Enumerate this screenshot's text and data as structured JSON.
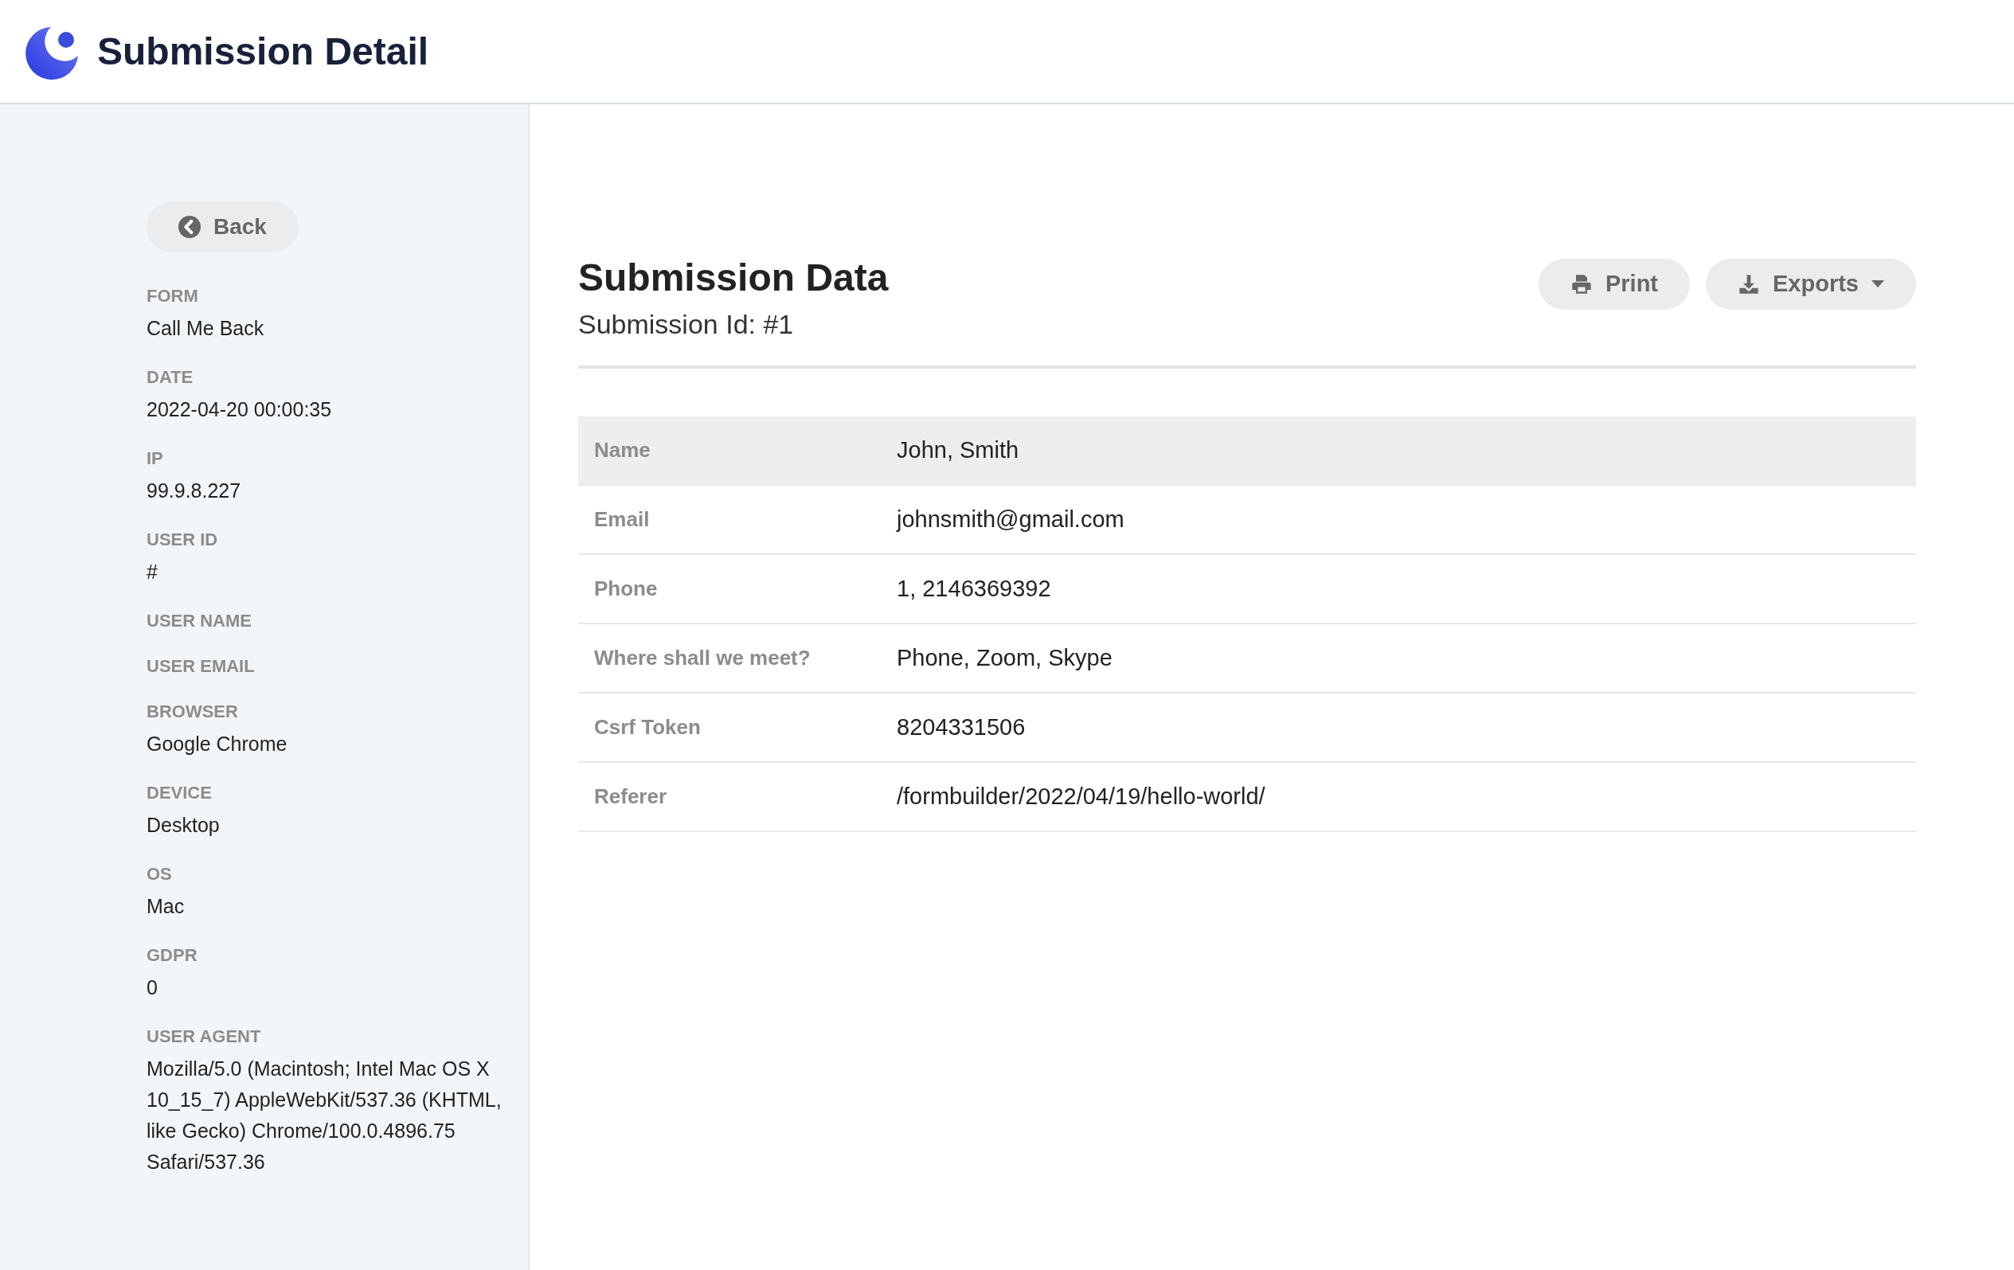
{
  "header": {
    "title": "Submission Detail"
  },
  "sidebar": {
    "back_button": "Back",
    "fields": [
      {
        "label": "FORM",
        "value": "Call Me Back"
      },
      {
        "label": "DATE",
        "value": "2022-04-20 00:00:35"
      },
      {
        "label": "IP",
        "value": "99.9.8.227"
      },
      {
        "label": "USER ID",
        "value": "#"
      },
      {
        "label": "USER NAME"
      },
      {
        "label": "USER EMAIL"
      },
      {
        "label": "BROWSER",
        "value": "Google Chrome"
      },
      {
        "label": "DEVICE",
        "value": "Desktop"
      },
      {
        "label": "OS",
        "value": "Mac"
      },
      {
        "label": "GDPR",
        "value": "0"
      },
      {
        "label": "USER AGENT",
        "value": "Mozilla/5.0 (Macintosh; Intel Mac OS X 10_15_7) AppleWebKit/537.36 (KHTML, like Gecko) Chrome/100.0.4896.75 Safari/537.36"
      }
    ]
  },
  "main": {
    "title": "Submission Data",
    "subtitle": "Submission Id: #1",
    "buttons": [
      {
        "kind": "print",
        "label": "Print"
      },
      {
        "kind": "exports",
        "label": "Exports"
      }
    ],
    "table": {
      "rows": [
        {
          "label": "Name",
          "value": "John, Smith",
          "selected": true
        },
        {
          "label": "Email",
          "value": "johnsmith@gmail.com",
          "selected": false
        },
        {
          "label": "Phone",
          "value": "1, 2146369392",
          "selected": false
        },
        {
          "label": "Where shall we meet?",
          "value": "Phone, Zoom, Skype",
          "selected": false
        },
        {
          "label": "Csrf Token",
          "value": "8204331506",
          "selected": false
        },
        {
          "label": "Referer",
          "value": "/formbuilder/2022/04/19/hello-world/",
          "selected": false
        }
      ]
    }
  }
}
